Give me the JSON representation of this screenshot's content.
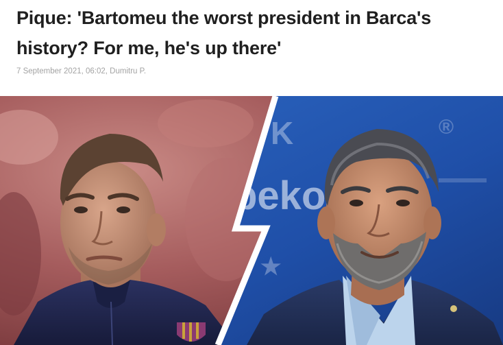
{
  "article": {
    "headline": "Pique: 'Bartomeu the worst president in Barca's history? For me, he's up there'",
    "meta": "7 September 2021, 06:02, Dumitru P."
  },
  "hero_image": {
    "subject": "split-portrait",
    "colors": {
      "left_background": "#a85a5e",
      "right_background": "#1f4fa8",
      "divider": "#ffffff"
    },
    "sponsor_text": "beko"
  }
}
